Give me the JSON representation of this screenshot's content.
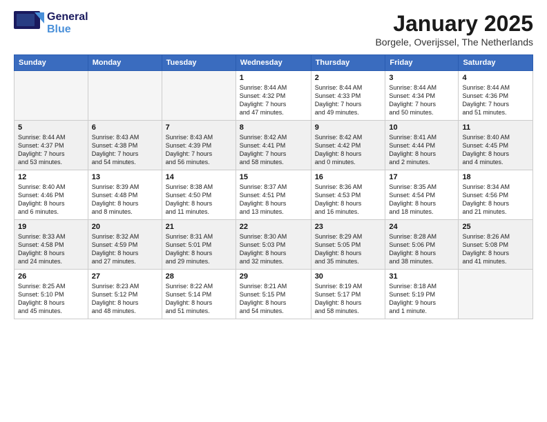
{
  "header": {
    "logo_general": "General",
    "logo_blue": "Blue",
    "month_title": "January 2025",
    "location": "Borgele, Overijssel, The Netherlands"
  },
  "days_of_week": [
    "Sunday",
    "Monday",
    "Tuesday",
    "Wednesday",
    "Thursday",
    "Friday",
    "Saturday"
  ],
  "weeks": [
    {
      "shaded": false,
      "days": [
        {
          "num": "",
          "info": ""
        },
        {
          "num": "",
          "info": ""
        },
        {
          "num": "",
          "info": ""
        },
        {
          "num": "1",
          "info": "Sunrise: 8:44 AM\nSunset: 4:32 PM\nDaylight: 7 hours\nand 47 minutes."
        },
        {
          "num": "2",
          "info": "Sunrise: 8:44 AM\nSunset: 4:33 PM\nDaylight: 7 hours\nand 49 minutes."
        },
        {
          "num": "3",
          "info": "Sunrise: 8:44 AM\nSunset: 4:34 PM\nDaylight: 7 hours\nand 50 minutes."
        },
        {
          "num": "4",
          "info": "Sunrise: 8:44 AM\nSunset: 4:36 PM\nDaylight: 7 hours\nand 51 minutes."
        }
      ]
    },
    {
      "shaded": true,
      "days": [
        {
          "num": "5",
          "info": "Sunrise: 8:44 AM\nSunset: 4:37 PM\nDaylight: 7 hours\nand 53 minutes."
        },
        {
          "num": "6",
          "info": "Sunrise: 8:43 AM\nSunset: 4:38 PM\nDaylight: 7 hours\nand 54 minutes."
        },
        {
          "num": "7",
          "info": "Sunrise: 8:43 AM\nSunset: 4:39 PM\nDaylight: 7 hours\nand 56 minutes."
        },
        {
          "num": "8",
          "info": "Sunrise: 8:42 AM\nSunset: 4:41 PM\nDaylight: 7 hours\nand 58 minutes."
        },
        {
          "num": "9",
          "info": "Sunrise: 8:42 AM\nSunset: 4:42 PM\nDaylight: 8 hours\nand 0 minutes."
        },
        {
          "num": "10",
          "info": "Sunrise: 8:41 AM\nSunset: 4:44 PM\nDaylight: 8 hours\nand 2 minutes."
        },
        {
          "num": "11",
          "info": "Sunrise: 8:40 AM\nSunset: 4:45 PM\nDaylight: 8 hours\nand 4 minutes."
        }
      ]
    },
    {
      "shaded": false,
      "days": [
        {
          "num": "12",
          "info": "Sunrise: 8:40 AM\nSunset: 4:46 PM\nDaylight: 8 hours\nand 6 minutes."
        },
        {
          "num": "13",
          "info": "Sunrise: 8:39 AM\nSunset: 4:48 PM\nDaylight: 8 hours\nand 8 minutes."
        },
        {
          "num": "14",
          "info": "Sunrise: 8:38 AM\nSunset: 4:50 PM\nDaylight: 8 hours\nand 11 minutes."
        },
        {
          "num": "15",
          "info": "Sunrise: 8:37 AM\nSunset: 4:51 PM\nDaylight: 8 hours\nand 13 minutes."
        },
        {
          "num": "16",
          "info": "Sunrise: 8:36 AM\nSunset: 4:53 PM\nDaylight: 8 hours\nand 16 minutes."
        },
        {
          "num": "17",
          "info": "Sunrise: 8:35 AM\nSunset: 4:54 PM\nDaylight: 8 hours\nand 18 minutes."
        },
        {
          "num": "18",
          "info": "Sunrise: 8:34 AM\nSunset: 4:56 PM\nDaylight: 8 hours\nand 21 minutes."
        }
      ]
    },
    {
      "shaded": true,
      "days": [
        {
          "num": "19",
          "info": "Sunrise: 8:33 AM\nSunset: 4:58 PM\nDaylight: 8 hours\nand 24 minutes."
        },
        {
          "num": "20",
          "info": "Sunrise: 8:32 AM\nSunset: 4:59 PM\nDaylight: 8 hours\nand 27 minutes."
        },
        {
          "num": "21",
          "info": "Sunrise: 8:31 AM\nSunset: 5:01 PM\nDaylight: 8 hours\nand 29 minutes."
        },
        {
          "num": "22",
          "info": "Sunrise: 8:30 AM\nSunset: 5:03 PM\nDaylight: 8 hours\nand 32 minutes."
        },
        {
          "num": "23",
          "info": "Sunrise: 8:29 AM\nSunset: 5:05 PM\nDaylight: 8 hours\nand 35 minutes."
        },
        {
          "num": "24",
          "info": "Sunrise: 8:28 AM\nSunset: 5:06 PM\nDaylight: 8 hours\nand 38 minutes."
        },
        {
          "num": "25",
          "info": "Sunrise: 8:26 AM\nSunset: 5:08 PM\nDaylight: 8 hours\nand 41 minutes."
        }
      ]
    },
    {
      "shaded": false,
      "days": [
        {
          "num": "26",
          "info": "Sunrise: 8:25 AM\nSunset: 5:10 PM\nDaylight: 8 hours\nand 45 minutes."
        },
        {
          "num": "27",
          "info": "Sunrise: 8:23 AM\nSunset: 5:12 PM\nDaylight: 8 hours\nand 48 minutes."
        },
        {
          "num": "28",
          "info": "Sunrise: 8:22 AM\nSunset: 5:14 PM\nDaylight: 8 hours\nand 51 minutes."
        },
        {
          "num": "29",
          "info": "Sunrise: 8:21 AM\nSunset: 5:15 PM\nDaylight: 8 hours\nand 54 minutes."
        },
        {
          "num": "30",
          "info": "Sunrise: 8:19 AM\nSunset: 5:17 PM\nDaylight: 8 hours\nand 58 minutes."
        },
        {
          "num": "31",
          "info": "Sunrise: 8:18 AM\nSunset: 5:19 PM\nDaylight: 9 hours\nand 1 minute."
        },
        {
          "num": "",
          "info": ""
        }
      ]
    }
  ]
}
